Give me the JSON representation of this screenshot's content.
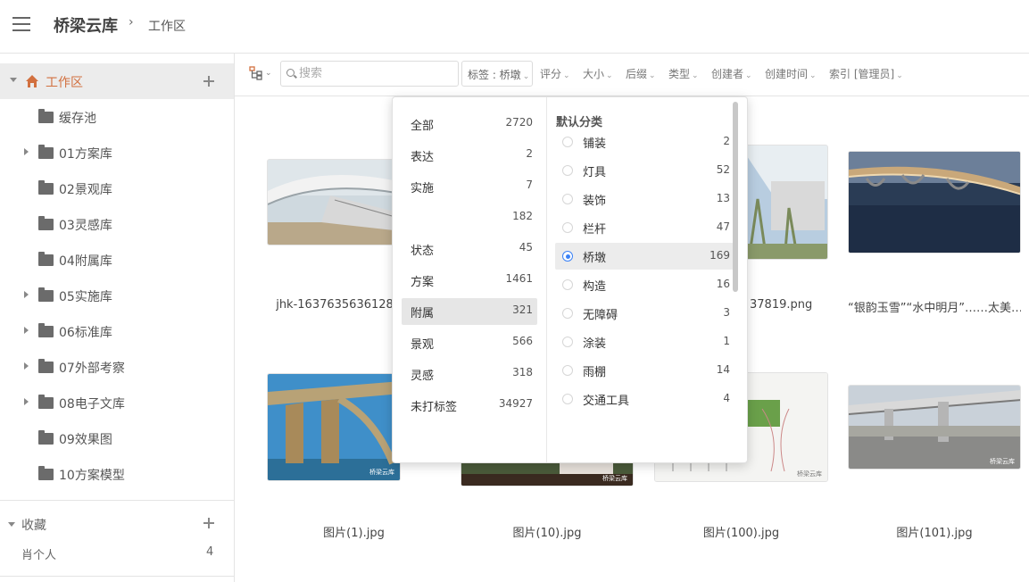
{
  "app": {
    "title": "桥梁云库",
    "breadcrumb_sep": "›",
    "breadcrumb": "工作区"
  },
  "sidebar": {
    "root_label": "工作区",
    "folders": [
      {
        "label": "缓存池",
        "expandable": false
      },
      {
        "label": "01方案库",
        "expandable": true
      },
      {
        "label": "02景观库",
        "expandable": false
      },
      {
        "label": "03灵感库",
        "expandable": false
      },
      {
        "label": "04附属库",
        "expandable": false
      },
      {
        "label": "05实施库",
        "expandable": true
      },
      {
        "label": "06标准库",
        "expandable": true
      },
      {
        "label": "07外部考察",
        "expandable": true
      },
      {
        "label": "08电子文库",
        "expandable": true
      },
      {
        "label": "09效果图",
        "expandable": false
      },
      {
        "label": "10方案模型",
        "expandable": false
      }
    ],
    "favorites": {
      "label": "收藏",
      "item": "肖个人",
      "count": "4"
    }
  },
  "toolbar": {
    "search_placeholder": "搜索",
    "tag_filter": "标签 : 桥墩",
    "filters": [
      "评分",
      "大小",
      "后缀",
      "类型",
      "创建者",
      "创建时间",
      "索引 [管理员]"
    ]
  },
  "grid": {
    "captions": [
      "jhk-1637635636128",
      "",
      "37819.png",
      "“银韵玉雪”“水中明月”……太美…",
      "图片(1).jpg",
      "图片(10).jpg",
      "图片(100).jpg",
      "图片(101).jpg"
    ],
    "watermark": "桥梁云库"
  },
  "tag_dropdown": {
    "groups": [
      {
        "label": "全部",
        "count": "2720"
      },
      {
        "label": "表达",
        "count": "2"
      },
      {
        "label": "实施",
        "count": "7"
      },
      {
        "label": "",
        "count": "182"
      },
      {
        "label": "状态",
        "count": "45"
      },
      {
        "label": "方案",
        "count": "1461"
      },
      {
        "label": "附属",
        "count": "321",
        "selected": true
      },
      {
        "label": "景观",
        "count": "566"
      },
      {
        "label": "灵感",
        "count": "318"
      },
      {
        "label": "未打标签",
        "count": "34927"
      }
    ],
    "category_title": "默认分类",
    "tags": [
      {
        "label": "铺装",
        "count": "2"
      },
      {
        "label": "灯具",
        "count": "52"
      },
      {
        "label": "装饰",
        "count": "13"
      },
      {
        "label": "栏杆",
        "count": "47"
      },
      {
        "label": "桥墩",
        "count": "169",
        "selected": true
      },
      {
        "label": "构造",
        "count": "16"
      },
      {
        "label": "无障碍",
        "count": "3"
      },
      {
        "label": "涂装",
        "count": "1"
      },
      {
        "label": "雨棚",
        "count": "14"
      },
      {
        "label": "交通工具",
        "count": "4"
      }
    ]
  },
  "colors": {
    "accent": "#d2703f",
    "radio_selected": "#3b82f6",
    "selected_bg": "#e6e6e6"
  }
}
